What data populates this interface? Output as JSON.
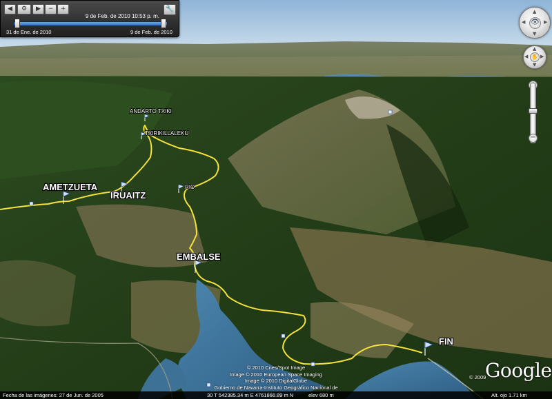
{
  "time_slider": {
    "current_label": "9 de Feb. de 2010  10:53 p. m.",
    "start_date": "31 de Ene. de 2010",
    "end_date": "9 de Feb. de 2010"
  },
  "map": {
    "placemarks": [
      {
        "label": "AMETZUETA",
        "size": "big"
      },
      {
        "label": "IRUAITZ",
        "size": "big"
      },
      {
        "label": "ANDARTO TXIKI",
        "size": "small"
      },
      {
        "label": "TXIRIKILLALEKU",
        "size": "small"
      },
      {
        "label": "RIO",
        "size": "small"
      },
      {
        "label": "EMBALSE",
        "size": "big"
      },
      {
        "label": "FIN",
        "size": "big"
      }
    ],
    "track_color": "#f5e23b",
    "water_color": "#3a6f9a"
  },
  "credits": {
    "line1": "© 2010 Cnes/Spot Image",
    "line2": "Image © 2010 European Space Imaging",
    "line3": "Image © 2010 DigitalGlobe",
    "line4": "Gobierno de Navarra-Instituto Geográfico Nacional de España"
  },
  "logo": {
    "text": "Google",
    "year": "© 2009"
  },
  "status_bar": {
    "imagery_date": "Fecha de las imágenes: 27 de Jun. de 2005",
    "coordinates": "30 T 542385.34 m E 4761866.89 m N",
    "elevation": "elev   680 m",
    "eye_alt": "Alt. ojo    1.71 km"
  }
}
